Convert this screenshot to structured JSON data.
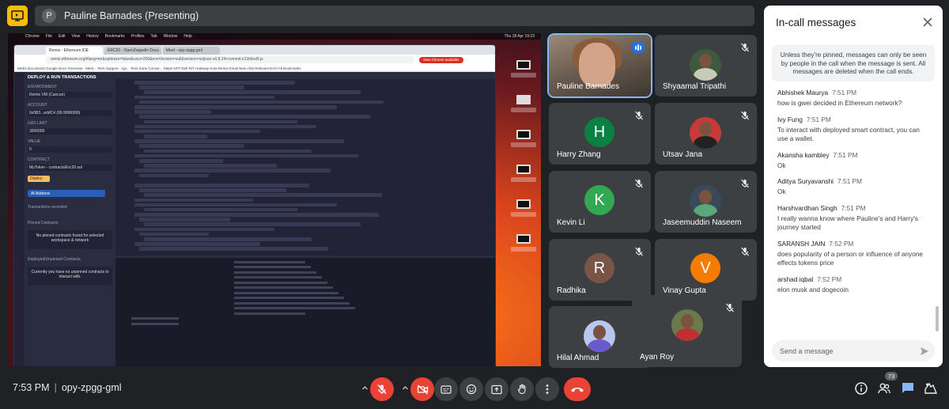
{
  "header": {
    "presenter_initial": "P",
    "presenting_title": "Pauline Barnades (Presenting)"
  },
  "presentation": {
    "mac_menu": [
      "Chrome",
      "File",
      "Edit",
      "View",
      "History",
      "Bookmarks",
      "Profiles",
      "Tab",
      "Window",
      "Help"
    ],
    "mac_clock": "Thu 18 Apr 19:23",
    "tabs": [
      "Remix - Ethereum IDE",
      "ERC20 - OpenZeppelin Docs",
      "Meet - opy-zpgg-gml"
    ],
    "url": "remix.ethereum.org/#lang=en&optimize=false&runs=200&evmVersion=null&version=soljson-v0.8.24+commit.e11b9ed9.js",
    "update_label": "New Chrome available",
    "bookmarks": "Web3 documents   Google Docs   Overview - Ment...   Tech Support - Aja...   Time Zone Conver...   Steps   NFT-Defi   RIT redeway   Kota   Rema   Gmail   New chat   Relevant DAO   All Bookmarks",
    "remix_header": "DEPLOY & RUN TRANSACTIONS",
    "remix_side_labels": [
      "ENVIRONMENT",
      "Remix VM (Cancun)",
      "ACCOUNT",
      "0x5B3...eddC4 (99.9999999)",
      "GAS LIMIT",
      "3000000",
      "VALUE",
      "0",
      "Wei",
      "CONTRACT",
      "MyToken - contracts/Erc20.sol",
      "Deploy",
      "At Address",
      "Transactions recorded",
      "Pinned Contracts",
      "No pinned contracts found for selected workspace & network",
      "Deployed/Unpinned Contracts",
      "Currently you have no unpinned contracts to interact with."
    ],
    "desktop_files": [
      "Screenshot 2024-0...17.27.42",
      "tbh.pdf",
      "Screenshot 2024-0...19.07.28",
      "Screenshot 2024-0...18.21.59",
      "Screenshot 2024-0...14.43.38",
      "Screenshot 2024-0...14.54.36"
    ]
  },
  "participants": [
    {
      "name": "Pauline Barnades",
      "kind": "video",
      "speaking": true
    },
    {
      "name": "Shyaamal Tripathi",
      "kind": "photo",
      "muted": true,
      "photo_bg": "#3d5a3a",
      "photo_body": "#c9c9b8"
    },
    {
      "name": "Harry Zhang",
      "initial": "H",
      "color": "#0b8043",
      "muted": true
    },
    {
      "name": "Utsav Jana",
      "kind": "photo",
      "muted": true,
      "photo_bg": "#c63a3a",
      "photo_body": "#222"
    },
    {
      "name": "Kevin Li",
      "initial": "K",
      "color": "#33a852",
      "muted": true
    },
    {
      "name": "Jaseemuddin Naseem",
      "kind": "photo",
      "muted": true,
      "photo_bg": "#3a4a5a",
      "photo_body": "#5aa77a"
    },
    {
      "name": "Radhika",
      "initial": "R",
      "color": "#795548",
      "muted": true
    },
    {
      "name": "Vinay Gupta",
      "initial": "V",
      "color": "#f57c00",
      "muted": true
    },
    {
      "name": "Hilal Ahmad",
      "kind": "photo",
      "muted": false,
      "photo_bg": "#b9c7f0",
      "photo_body": "#6a5acd"
    },
    {
      "name": "Ayan Roy",
      "kind": "photo",
      "muted": true,
      "photo_bg": "#6a7a4a",
      "photo_body": "#c03030"
    }
  ],
  "chat": {
    "title": "In-call messages",
    "notice": "Unless they're pinned, messages can only be seen by people in the call when the message is sent. All messages are deleted when the call ends.",
    "messages": [
      {
        "sender": "Abhishek Maurya",
        "time": "7:51 PM",
        "text": "how is gwei decided in Ethereum network?"
      },
      {
        "sender": "Ivy Fung",
        "time": "7:51 PM",
        "text": "To interact with deployed smart contract, you can use a wallet."
      },
      {
        "sender": "Akansha kambley",
        "time": "7:51 PM",
        "text": "Ok"
      },
      {
        "sender": "Aditya Suryavanshi",
        "time": "7:51 PM",
        "text": "Ok"
      },
      {
        "sender": "Harshvardhan Singh",
        "time": "7:51 PM",
        "text": "I really wanna know where Pauline's and Harry's journey started"
      },
      {
        "sender": "SARANSH JAIN",
        "time": "7:52 PM",
        "text": "does popularity of a person or influence of anyone effects tokens price"
      },
      {
        "sender": "arshad iqbal",
        "time": "7:52 PM",
        "text": "elon musk and dogecoin"
      }
    ],
    "input_placeholder": "Send a message"
  },
  "footer": {
    "time": "7:53 PM",
    "separator": "|",
    "meeting_code": "opy-zpgg-gml",
    "people_count": "73"
  },
  "colors": {
    "background": "#202124",
    "tile": "#3c4043",
    "danger": "#ea4335",
    "accent": "#8ab4f8"
  }
}
